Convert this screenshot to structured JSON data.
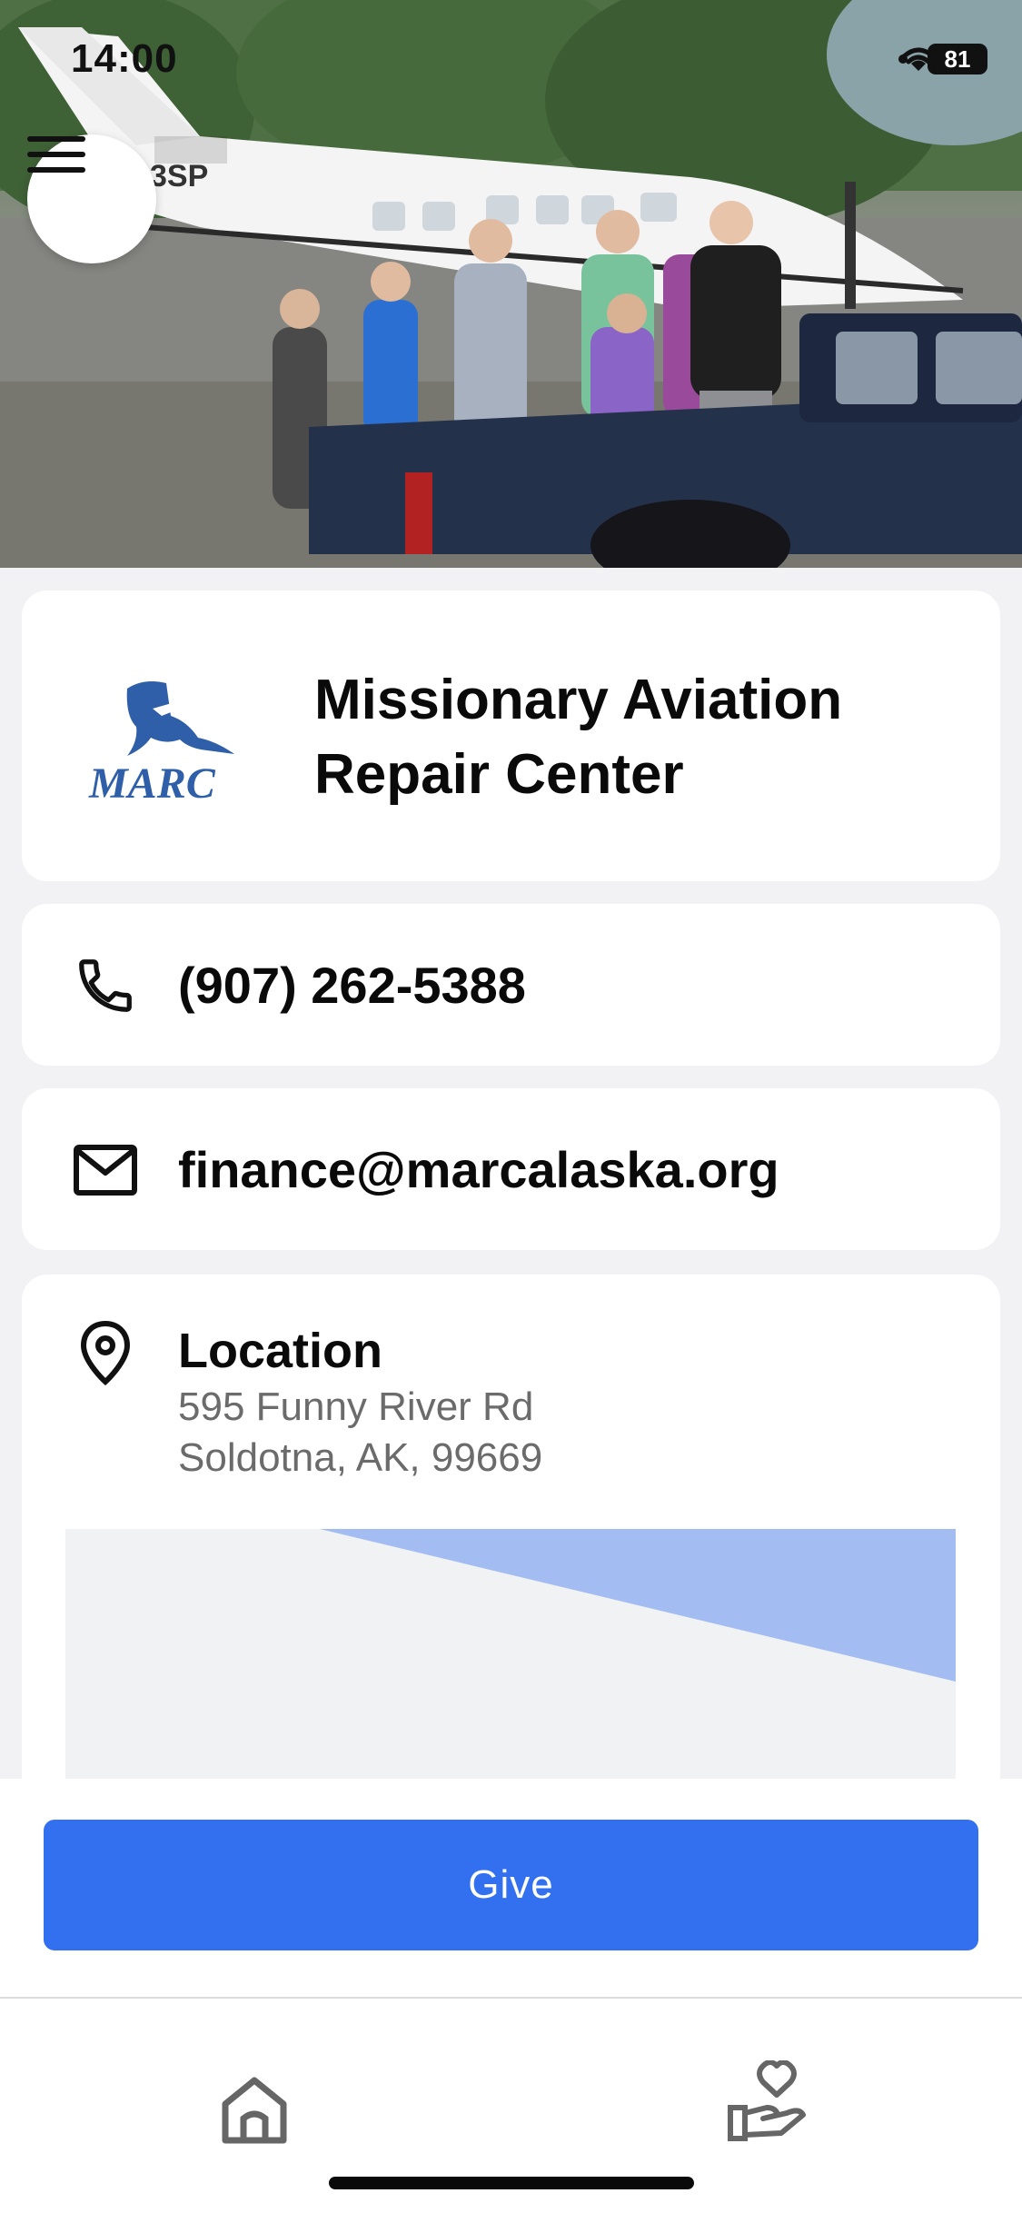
{
  "status_bar": {
    "time": "14:00",
    "battery": "81",
    "icons": [
      "signal-dot-icon",
      "wifi-icon",
      "battery-icon"
    ]
  },
  "hero": {
    "image": "photo-group-with-airplane-and-truck",
    "menu_icon": "hamburger-menu-icon"
  },
  "organization": {
    "logo_text": "MARC",
    "name": "Missionary Aviation Repair Center"
  },
  "contact": {
    "phone": "(907) 262-5388",
    "phone_icon": "phone-icon",
    "email": "finance@marcalaska.org",
    "email_icon": "mail-icon"
  },
  "location": {
    "icon": "map-pin-icon",
    "title": "Location",
    "address_line1": "595 Funny River Rd",
    "address_line2": "Soldotna, AK, 99669"
  },
  "give_button": {
    "label": "Give"
  },
  "tab_bar": {
    "tabs": [
      {
        "name": "home",
        "icon": "home-icon"
      },
      {
        "name": "give",
        "icon": "hand-heart-icon"
      }
    ]
  },
  "colors": {
    "accent": "#3370f0",
    "map_water": "#a3bdf3",
    "logo_blue": "#2f5fa8"
  }
}
